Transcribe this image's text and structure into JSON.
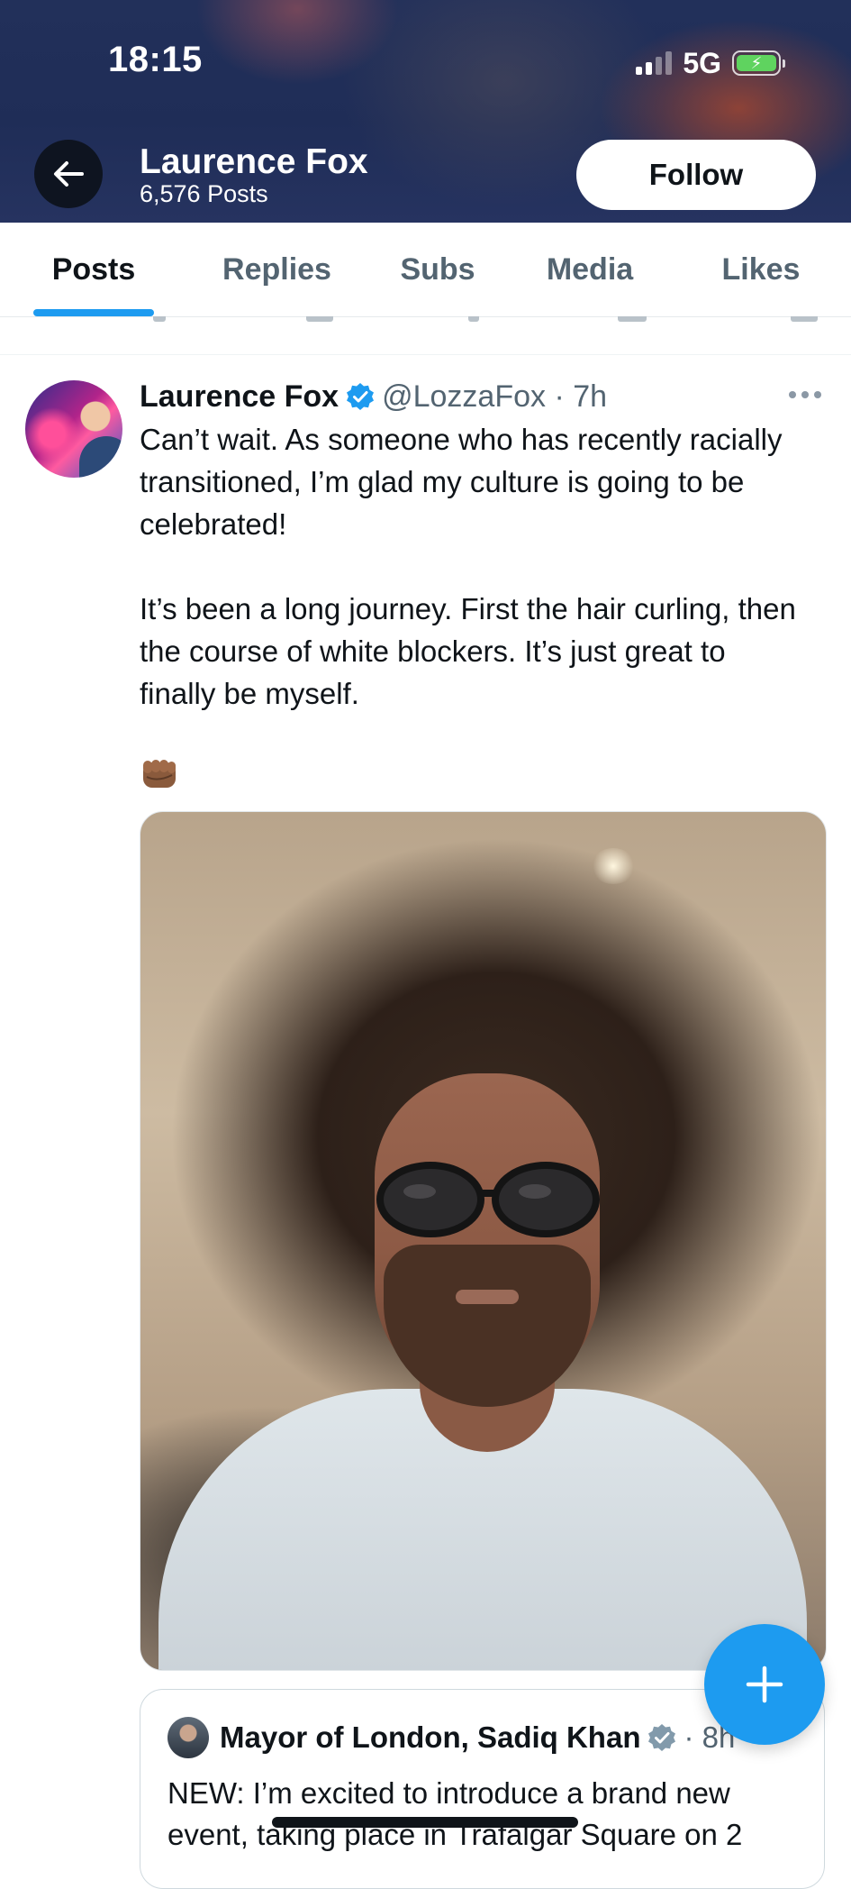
{
  "status_bar": {
    "time": "18:15",
    "network": "5G",
    "battery_icon": "battery-charging-icon"
  },
  "header": {
    "back_icon": "arrow-left-icon",
    "name": "Laurence Fox",
    "post_count": "6,576 Posts",
    "follow_label": "Follow"
  },
  "tabs": [
    {
      "label": "Posts",
      "active": true
    },
    {
      "label": "Replies",
      "active": false
    },
    {
      "label": "Subs",
      "active": false
    },
    {
      "label": "Media",
      "active": false
    },
    {
      "label": "Likes",
      "active": false
    }
  ],
  "post": {
    "author_name": "Laurence Fox",
    "handle": "@LozzaFox",
    "time": "7h",
    "meta": "@LozzaFox · 7h",
    "text_p1": "Can’t wait. As someone who has recently racially transitioned, I’m glad my culture is going to be celebrated!",
    "text_p2": "It’s been a long journey. First the hair curling, then the course of white blockers. It’s just great to finally be myself.",
    "emoji": "👊🏾",
    "image_alt": "selfie photo of man with large curly afro wig and sunglasses"
  },
  "quoted_post": {
    "author_name": "Mayor of London, Sadiq Khan",
    "meta": "· 8h",
    "text": "NEW: I’m excited to introduce a brand new event, taking place in Trafalgar Square on 2"
  },
  "colors": {
    "accent": "#1d9bf0",
    "text_primary": "#0f1419",
    "text_secondary": "#536471",
    "header_bg": "#22305a"
  }
}
